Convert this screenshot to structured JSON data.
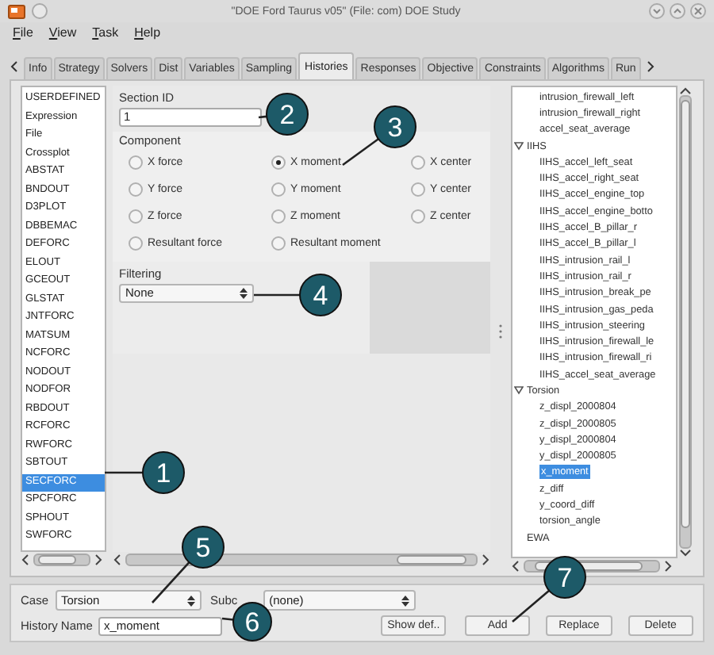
{
  "window": {
    "title": "\"DOE Ford Taurus v05\" (File: com)  DOE Study"
  },
  "menu": [
    "File",
    "View",
    "Task",
    "Help"
  ],
  "tabs": [
    {
      "label": "Info",
      "selected": false
    },
    {
      "label": "Strategy",
      "selected": false
    },
    {
      "label": "Solvers",
      "selected": false
    },
    {
      "label": "Dist",
      "selected": false
    },
    {
      "label": "Variables",
      "selected": false
    },
    {
      "label": "Sampling",
      "selected": false
    },
    {
      "label": "Histories",
      "selected": true
    },
    {
      "label": "Responses",
      "selected": false
    },
    {
      "label": "Objective",
      "selected": false
    },
    {
      "label": "Constraints",
      "selected": false
    },
    {
      "label": "Algorithms",
      "selected": false
    },
    {
      "label": "Run",
      "selected": false
    }
  ],
  "history_types": [
    {
      "label": "USERDEFINED",
      "selected": false
    },
    {
      "label": "Expression",
      "selected": false
    },
    {
      "label": "File",
      "selected": false
    },
    {
      "label": "Crossplot",
      "selected": false
    },
    {
      "label": "ABSTAT",
      "selected": false
    },
    {
      "label": "BNDOUT",
      "selected": false
    },
    {
      "label": "D3PLOT",
      "selected": false
    },
    {
      "label": "DBBEMAC",
      "selected": false
    },
    {
      "label": "DEFORC",
      "selected": false
    },
    {
      "label": "ELOUT",
      "selected": false
    },
    {
      "label": "GCEOUT",
      "selected": false
    },
    {
      "label": "GLSTAT",
      "selected": false
    },
    {
      "label": "JNTFORC",
      "selected": false
    },
    {
      "label": "MATSUM",
      "selected": false
    },
    {
      "label": "NCFORC",
      "selected": false
    },
    {
      "label": "NODOUT",
      "selected": false
    },
    {
      "label": "NODFOR",
      "selected": false
    },
    {
      "label": "RBDOUT",
      "selected": false
    },
    {
      "label": "RCFORC",
      "selected": false
    },
    {
      "label": "RWFORC",
      "selected": false
    },
    {
      "label": "SBTOUT",
      "selected": false
    },
    {
      "label": "SECFORC",
      "selected": true
    },
    {
      "label": "SPCFORC",
      "selected": false
    },
    {
      "label": "SPHOUT",
      "selected": false
    },
    {
      "label": "SWFORC",
      "selected": false
    }
  ],
  "section_id": {
    "label": "Section ID",
    "value": "1"
  },
  "component": {
    "label": "Component",
    "options": [
      {
        "label": "X force",
        "selected": false
      },
      {
        "label": "Y force",
        "selected": false
      },
      {
        "label": "Z force",
        "selected": false
      },
      {
        "label": "Resultant force",
        "selected": false
      },
      {
        "label": "X moment",
        "selected": true
      },
      {
        "label": "Y moment",
        "selected": false
      },
      {
        "label": "Z moment",
        "selected": false
      },
      {
        "label": "Resultant moment",
        "selected": false
      },
      {
        "label": "X center",
        "selected": false
      },
      {
        "label": "Y center",
        "selected": false
      },
      {
        "label": "Z center",
        "selected": false
      }
    ]
  },
  "filtering": {
    "label": "Filtering",
    "value": "None"
  },
  "tree": [
    {
      "children": [
        {
          "label": "intrusion_firewall_left",
          "selected": false
        },
        {
          "label": "intrusion_firewall_right",
          "selected": false
        },
        {
          "label": "accel_seat_average",
          "selected": false
        }
      ]
    },
    {
      "label": "IIHS",
      "expanded": true,
      "selected": false,
      "children": [
        {
          "label": "IIHS_accel_left_seat",
          "selected": false
        },
        {
          "label": "IIHS_accel_right_seat",
          "selected": false
        },
        {
          "label": "IIHS_accel_engine_top",
          "selected": false
        },
        {
          "label": "IIHS_accel_engine_botto",
          "selected": false
        },
        {
          "label": "IIHS_accel_B_pillar_r",
          "selected": false
        },
        {
          "label": "IIHS_accel_B_pillar_l",
          "selected": false
        },
        {
          "label": "IIHS_intrusion_rail_l",
          "selected": false
        },
        {
          "label": "IIHS_intrusion_rail_r",
          "selected": false
        },
        {
          "label": "IIHS_intrusion_break_pe",
          "selected": false
        },
        {
          "label": "IIHS_intrusion_gas_peda",
          "selected": false
        },
        {
          "label": "IIHS_intrusion_steering",
          "selected": false
        },
        {
          "label": "IIHS_intrusion_firewall_le",
          "selected": false
        },
        {
          "label": "IIHS_intrusion_firewall_ri",
          "selected": false
        },
        {
          "label": "IIHS_accel_seat_average",
          "selected": false
        }
      ]
    },
    {
      "label": "Torsion",
      "expanded": true,
      "selected": false,
      "children": [
        {
          "label": "z_displ_2000804",
          "selected": false
        },
        {
          "label": "z_displ_2000805",
          "selected": false
        },
        {
          "label": "y_displ_2000804",
          "selected": false
        },
        {
          "label": "y_displ_2000805",
          "selected": false
        },
        {
          "label": "x_moment",
          "selected": true
        },
        {
          "label": "z_diff",
          "selected": false
        },
        {
          "label": "y_coord_diff",
          "selected": false
        },
        {
          "label": "torsion_angle",
          "selected": false
        }
      ]
    },
    {
      "label": "EWA",
      "selected": false
    }
  ],
  "case": {
    "label": "Case",
    "value": "Torsion"
  },
  "subcase": {
    "label": "Subc",
    "value": "(none)"
  },
  "history_name": {
    "label": "History Name",
    "value": "x_moment"
  },
  "buttons": [
    "Show def..",
    "Add",
    "Replace",
    "Delete"
  ],
  "callouts": [
    "1",
    "2",
    "3",
    "4",
    "5",
    "6",
    "7"
  ]
}
